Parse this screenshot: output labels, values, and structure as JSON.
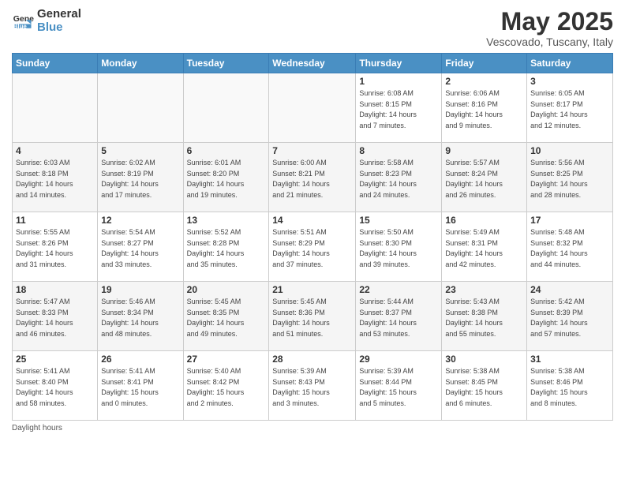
{
  "logo": {
    "text_general": "General",
    "text_blue": "Blue"
  },
  "header": {
    "month_year": "May 2025",
    "location": "Vescovado, Tuscany, Italy"
  },
  "weekdays": [
    "Sunday",
    "Monday",
    "Tuesday",
    "Wednesday",
    "Thursday",
    "Friday",
    "Saturday"
  ],
  "weeks": [
    [
      {
        "day": "",
        "info": ""
      },
      {
        "day": "",
        "info": ""
      },
      {
        "day": "",
        "info": ""
      },
      {
        "day": "",
        "info": ""
      },
      {
        "day": "1",
        "info": "Sunrise: 6:08 AM\nSunset: 8:15 PM\nDaylight: 14 hours\nand 7 minutes."
      },
      {
        "day": "2",
        "info": "Sunrise: 6:06 AM\nSunset: 8:16 PM\nDaylight: 14 hours\nand 9 minutes."
      },
      {
        "day": "3",
        "info": "Sunrise: 6:05 AM\nSunset: 8:17 PM\nDaylight: 14 hours\nand 12 minutes."
      }
    ],
    [
      {
        "day": "4",
        "info": "Sunrise: 6:03 AM\nSunset: 8:18 PM\nDaylight: 14 hours\nand 14 minutes."
      },
      {
        "day": "5",
        "info": "Sunrise: 6:02 AM\nSunset: 8:19 PM\nDaylight: 14 hours\nand 17 minutes."
      },
      {
        "day": "6",
        "info": "Sunrise: 6:01 AM\nSunset: 8:20 PM\nDaylight: 14 hours\nand 19 minutes."
      },
      {
        "day": "7",
        "info": "Sunrise: 6:00 AM\nSunset: 8:21 PM\nDaylight: 14 hours\nand 21 minutes."
      },
      {
        "day": "8",
        "info": "Sunrise: 5:58 AM\nSunset: 8:23 PM\nDaylight: 14 hours\nand 24 minutes."
      },
      {
        "day": "9",
        "info": "Sunrise: 5:57 AM\nSunset: 8:24 PM\nDaylight: 14 hours\nand 26 minutes."
      },
      {
        "day": "10",
        "info": "Sunrise: 5:56 AM\nSunset: 8:25 PM\nDaylight: 14 hours\nand 28 minutes."
      }
    ],
    [
      {
        "day": "11",
        "info": "Sunrise: 5:55 AM\nSunset: 8:26 PM\nDaylight: 14 hours\nand 31 minutes."
      },
      {
        "day": "12",
        "info": "Sunrise: 5:54 AM\nSunset: 8:27 PM\nDaylight: 14 hours\nand 33 minutes."
      },
      {
        "day": "13",
        "info": "Sunrise: 5:52 AM\nSunset: 8:28 PM\nDaylight: 14 hours\nand 35 minutes."
      },
      {
        "day": "14",
        "info": "Sunrise: 5:51 AM\nSunset: 8:29 PM\nDaylight: 14 hours\nand 37 minutes."
      },
      {
        "day": "15",
        "info": "Sunrise: 5:50 AM\nSunset: 8:30 PM\nDaylight: 14 hours\nand 39 minutes."
      },
      {
        "day": "16",
        "info": "Sunrise: 5:49 AM\nSunset: 8:31 PM\nDaylight: 14 hours\nand 42 minutes."
      },
      {
        "day": "17",
        "info": "Sunrise: 5:48 AM\nSunset: 8:32 PM\nDaylight: 14 hours\nand 44 minutes."
      }
    ],
    [
      {
        "day": "18",
        "info": "Sunrise: 5:47 AM\nSunset: 8:33 PM\nDaylight: 14 hours\nand 46 minutes."
      },
      {
        "day": "19",
        "info": "Sunrise: 5:46 AM\nSunset: 8:34 PM\nDaylight: 14 hours\nand 48 minutes."
      },
      {
        "day": "20",
        "info": "Sunrise: 5:45 AM\nSunset: 8:35 PM\nDaylight: 14 hours\nand 49 minutes."
      },
      {
        "day": "21",
        "info": "Sunrise: 5:45 AM\nSunset: 8:36 PM\nDaylight: 14 hours\nand 51 minutes."
      },
      {
        "day": "22",
        "info": "Sunrise: 5:44 AM\nSunset: 8:37 PM\nDaylight: 14 hours\nand 53 minutes."
      },
      {
        "day": "23",
        "info": "Sunrise: 5:43 AM\nSunset: 8:38 PM\nDaylight: 14 hours\nand 55 minutes."
      },
      {
        "day": "24",
        "info": "Sunrise: 5:42 AM\nSunset: 8:39 PM\nDaylight: 14 hours\nand 57 minutes."
      }
    ],
    [
      {
        "day": "25",
        "info": "Sunrise: 5:41 AM\nSunset: 8:40 PM\nDaylight: 14 hours\nand 58 minutes."
      },
      {
        "day": "26",
        "info": "Sunrise: 5:41 AM\nSunset: 8:41 PM\nDaylight: 15 hours\nand 0 minutes."
      },
      {
        "day": "27",
        "info": "Sunrise: 5:40 AM\nSunset: 8:42 PM\nDaylight: 15 hours\nand 2 minutes."
      },
      {
        "day": "28",
        "info": "Sunrise: 5:39 AM\nSunset: 8:43 PM\nDaylight: 15 hours\nand 3 minutes."
      },
      {
        "day": "29",
        "info": "Sunrise: 5:39 AM\nSunset: 8:44 PM\nDaylight: 15 hours\nand 5 minutes."
      },
      {
        "day": "30",
        "info": "Sunrise: 5:38 AM\nSunset: 8:45 PM\nDaylight: 15 hours\nand 6 minutes."
      },
      {
        "day": "31",
        "info": "Sunrise: 5:38 AM\nSunset: 8:46 PM\nDaylight: 15 hours\nand 8 minutes."
      }
    ]
  ],
  "footer": {
    "daylight_label": "Daylight hours"
  }
}
